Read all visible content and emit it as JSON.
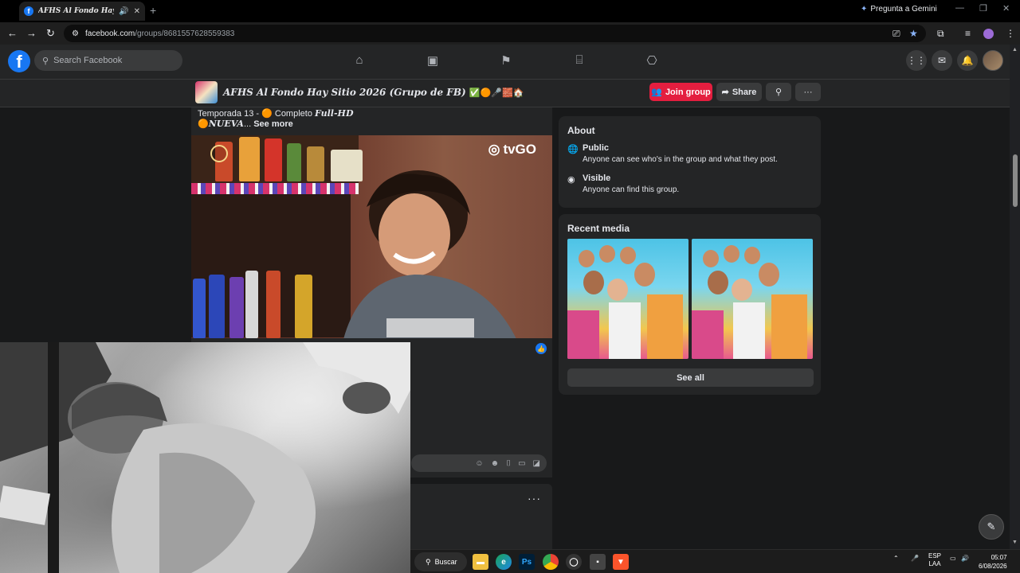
{
  "browser": {
    "tab_title": "AFHS Al Fondo Hay Sitio",
    "new_tab": "+",
    "gemini_label": "Pregunta a Gemini",
    "url_host": "facebook.com",
    "url_path": "/groups/8681557628559383"
  },
  "fb_header": {
    "logo": "f",
    "search_placeholder": "Search Facebook",
    "nav_icons": [
      "home-icon",
      "video-icon",
      "pages-icon",
      "marketplace-icon",
      "gaming-icon"
    ]
  },
  "group": {
    "name": "AFHS Al Fondo Hay Sitio 2026 (Grupo de FB)",
    "name_emojis": "✅🟠🎤🧱🏠",
    "join_label": "Join group",
    "share_label": "Share"
  },
  "post": {
    "line1_prefix": "Temporada 13 - ",
    "line1_emoji": "🟠",
    "line1_mid": " Completo ",
    "line1_hd": "Full-HD",
    "line2_emoji": "🟠",
    "line2_bold": "NUEVA",
    "line2_ellipsis": "...",
    "see_more": "See more",
    "video_brand": "tvGO"
  },
  "about": {
    "title": "About",
    "public_title": "Public",
    "public_desc": "Anyone can see who's in the group and what they post.",
    "visible_title": "Visible",
    "visible_desc": "Anyone can find this group."
  },
  "recent_media": {
    "title": "Recent media",
    "see_all": "See all"
  },
  "taskbar": {
    "search_label": "Buscar",
    "apps": [
      "file-explorer",
      "edge",
      "photoshop",
      "chrome",
      "obs",
      "app",
      "brave"
    ],
    "lang_top": "ESP",
    "lang_bottom": "LAA",
    "time": "05:07",
    "date": "6/08/2026"
  },
  "colors": {
    "fb_blue": "#1877f2",
    "join_red": "#e41e3f",
    "surface": "#242526",
    "background": "#18191a"
  }
}
